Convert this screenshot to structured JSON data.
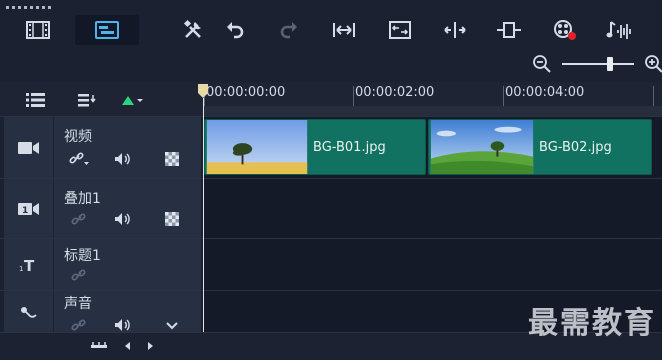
{
  "toolbar": {
    "icons": [
      "storyboard-view-icon",
      "timeline-view-icon",
      "tools-icon",
      "undo-icon",
      "redo-icon",
      "fit-project-icon",
      "smart-proxy-icon",
      "trim-icon",
      "resize-icon",
      "record-capture-icon",
      "sound-mixer-icon"
    ]
  },
  "zoom": {
    "level_fraction": 0.66
  },
  "ruler": {
    "timecodes": [
      "00:00:00:00",
      "00:00:02:00",
      "00:00:04:00"
    ]
  },
  "tracks": [
    {
      "name": "视频",
      "icon": "video-track-icon"
    },
    {
      "name": "叠加1",
      "icon": "overlay-track-icon"
    },
    {
      "name": "标题1",
      "icon": "title-track-icon"
    },
    {
      "name": "声音",
      "icon": "voice-track-icon"
    }
  ],
  "clips": [
    {
      "label": "BG-B01.jpg"
    },
    {
      "label": "BG-B02.jpg"
    }
  ],
  "watermark": "最需教育",
  "colors": {
    "clip": "#117261",
    "background": "#1b2130",
    "track_header": "#273042",
    "active_button": "#121826",
    "record_dot": "#e0222a"
  }
}
